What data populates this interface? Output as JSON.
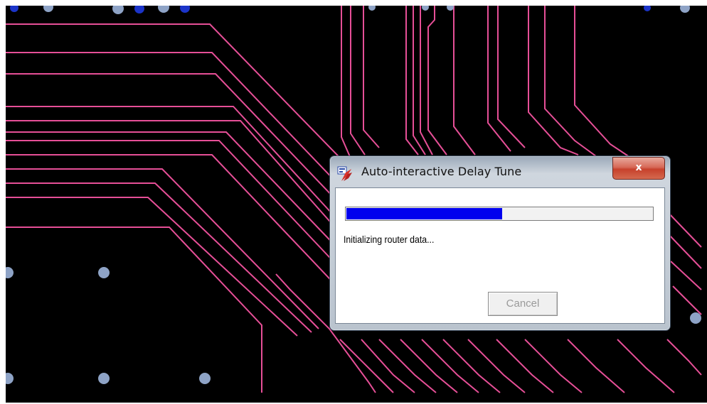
{
  "dialog": {
    "title": "Auto-interactive Delay Tune",
    "close_label": "x",
    "status": "Initializing router data...",
    "cancel_label": "Cancel",
    "progress": 0.51
  },
  "colors": {
    "board_background": "#000000",
    "trace": "#e64f97",
    "via": "#8ea3c6",
    "via_blue": "#1b34c9",
    "progress_fill": "#0000ee"
  },
  "icons": {
    "app_icon": "delay-tune-app-icon",
    "close_icon": "close-icon"
  }
}
